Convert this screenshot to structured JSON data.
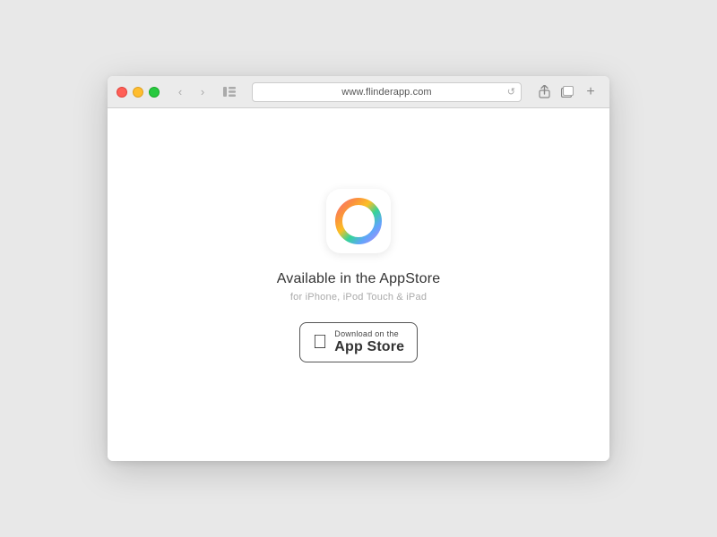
{
  "browser": {
    "url": "www.flinderapp.com",
    "traffic_lights": {
      "close_label": "close",
      "min_label": "minimize",
      "max_label": "maximize"
    },
    "nav": {
      "back": "‹",
      "forward": "›"
    },
    "reload": "↺",
    "share_icon": "⬆",
    "tabs_icon": "⧉",
    "add_tab": "+"
  },
  "page": {
    "available_text": "Available in the AppStore",
    "subtitle": "for iPhone, iPod Touch & iPad",
    "badge": {
      "download_on": "Download on the",
      "store_name": "App Store"
    }
  }
}
